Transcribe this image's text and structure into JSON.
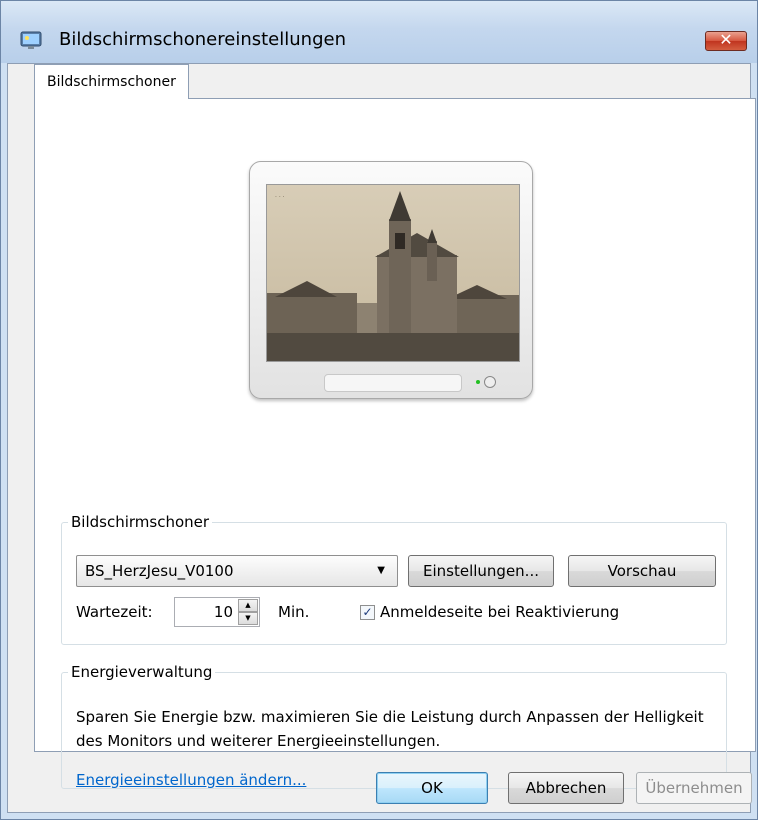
{
  "window": {
    "title": "Bildschirmschonereinstellungen"
  },
  "tabs": [
    {
      "label": "Bildschirmschoner"
    }
  ],
  "screensaver": {
    "group_label": "Bildschirmschoner",
    "selected": "BS_HerzJesu_V0100",
    "settings_button": "Einstellungen...",
    "preview_button": "Vorschau",
    "wait_label": "Wartezeit:",
    "wait_value": "10",
    "wait_unit": "Min.",
    "resume_checkbox_label": "Anmeldeseite bei Reaktivierung",
    "resume_checked": true
  },
  "power": {
    "group_label": "Energieverwaltung",
    "description": "Sparen Sie Energie bzw. maximieren Sie die Leistung durch Anpassen der Helligkeit des Monitors und weiterer Energieeinstellungen.",
    "link": "Energieeinstellungen ändern..."
  },
  "footer": {
    "ok": "OK",
    "cancel": "Abbrechen",
    "apply": "Übernehmen"
  }
}
